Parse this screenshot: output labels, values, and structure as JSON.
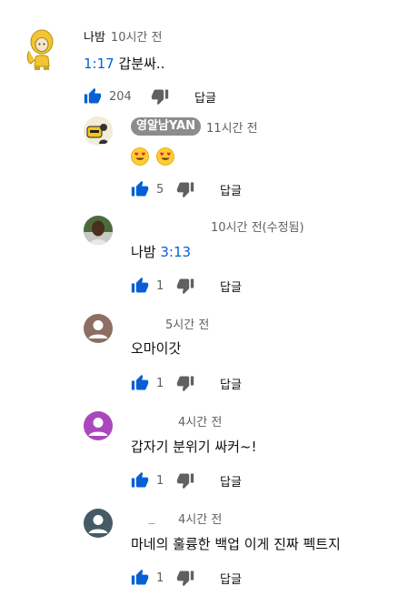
{
  "colors": {
    "like_blue": "#065fd4",
    "muted": "#606060",
    "pill_bg": "#8c8c8c"
  },
  "comments": [
    {
      "author": "나밤",
      "time": "10시간 전",
      "timestamp": "1:17",
      "text": "갑분싸..",
      "likes": "204",
      "reply": "답글",
      "avatar_icon": "yellow-character-avatar-icon"
    },
    {
      "author": "영알남YAN",
      "time": "11시간 전",
      "text": "",
      "emoji_count": 2,
      "emoji_icon": "heart-eyes-emoji-icon",
      "likes": "5",
      "reply": "답글",
      "avatar_icon": "channel-logo-avatar-icon"
    },
    {
      "author": "",
      "time": "10시간 전(수정됨)",
      "mention": "나밤",
      "timestamp": "3:13",
      "likes": "1",
      "reply": "답글",
      "avatar_icon": "person-photo-avatar-icon"
    },
    {
      "author": "",
      "time": "5시간 전",
      "text": "오마이갓",
      "likes": "1",
      "reply": "답글",
      "avatar_icon": "brown-default-avatar-icon"
    },
    {
      "author": "",
      "time": "4시간 전",
      "text": "갑자기 분위기 싸커~!",
      "likes": "1",
      "reply": "답글",
      "avatar_icon": "purple-default-avatar-icon"
    },
    {
      "author": "_",
      "time": "4시간 전",
      "text": "마네의 훌륭한 백업 이게 진짜 펙트지",
      "likes": "1",
      "reply": "답글",
      "avatar_icon": "slate-default-avatar-icon"
    }
  ]
}
